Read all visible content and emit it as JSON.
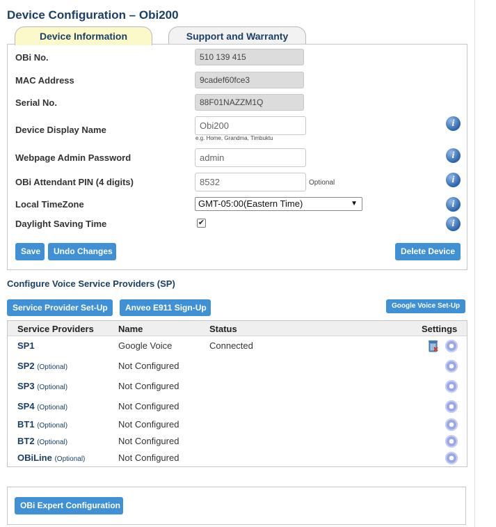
{
  "page": {
    "title": "Device Configuration – Obi200"
  },
  "tabs": [
    {
      "label": "Device Information",
      "active": true
    },
    {
      "label": "Support and Warranty",
      "active": false
    }
  ],
  "device_info": {
    "obi_no": {
      "label": "OBi No.",
      "value": "510 139 415"
    },
    "mac": {
      "label": "MAC Address",
      "value": "9cadef60fce3"
    },
    "serial": {
      "label": "Serial No.",
      "value": "88F01NAZZM1Q"
    },
    "display_name": {
      "label": "Device Display Name",
      "value": "Obi200",
      "hint": "e.g. Home, Grandma, Timbuktu"
    },
    "admin_password": {
      "label": "Webpage Admin Password",
      "value": "admin"
    },
    "attendant_pin": {
      "label": "OBi Attendant PIN (4 digits)",
      "value": "8532",
      "note": "Optional"
    },
    "timezone": {
      "label": "Local TimeZone",
      "value": "GMT-05:00(Eastern Time)",
      "arrow": "▼"
    },
    "dst": {
      "label": "Daylight Saving Time",
      "checked": true,
      "mark": "✔"
    },
    "info_glyph": "i",
    "buttons": {
      "save": "Save",
      "undo": "Undo Changes",
      "delete": "Delete Device"
    }
  },
  "voice_providers": {
    "title": "Configure Voice Service Providers (SP)",
    "buttons": {
      "sp_setup": "Service Provider Set-Up",
      "e911": "Anveo E911 Sign-Up",
      "google": "Google Voice Set-Up"
    },
    "headers": {
      "providers": "Service Providers",
      "name": "Name",
      "status": "Status",
      "settings": "Settings"
    },
    "rows": [
      {
        "id": "SP1",
        "optional": "",
        "name": "Google Voice",
        "status": "Connected",
        "trash": true
      },
      {
        "id": "SP2",
        "optional": "(Optional)",
        "name": "Not Configured",
        "status": "",
        "trash": false
      },
      {
        "id": "SP3",
        "optional": "(Optional)",
        "name": "Not Configured",
        "status": "",
        "trash": false
      },
      {
        "id": "SP4",
        "optional": "(Optional)",
        "name": "Not Configured",
        "status": "",
        "trash": false
      },
      {
        "id": "BT1",
        "optional": "(Optional)",
        "name": "Not Configured",
        "status": "",
        "trash": false
      },
      {
        "id": "BT2",
        "optional": "(Optional)",
        "name": "Not Configured",
        "status": "",
        "trash": false
      },
      {
        "id": "OBiLine",
        "optional": "(Optional)",
        "name": "Not Configured",
        "status": "",
        "trash": false
      }
    ]
  },
  "expert": {
    "button": "OBi Expert Configuration"
  },
  "colors": {
    "accent": "#3f90d5",
    "title": "#1b3f66",
    "active_tab": "#fbf8c9"
  }
}
